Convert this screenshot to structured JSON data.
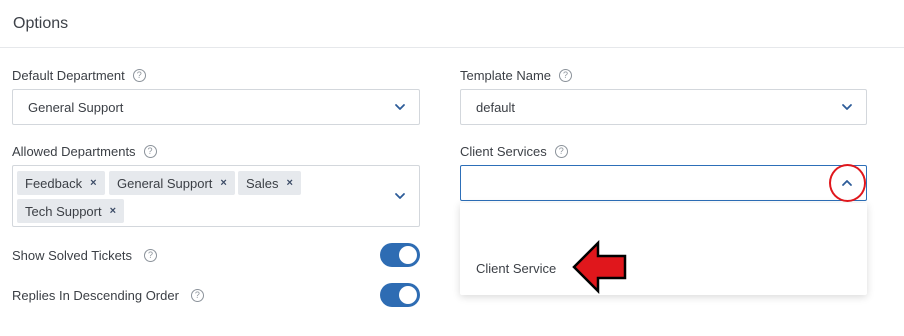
{
  "header": {
    "title": "Options"
  },
  "default_department": {
    "label": "Default Department",
    "value": "General Support"
  },
  "template_name": {
    "label": "Template Name",
    "value": "default"
  },
  "allowed_departments": {
    "label": "Allowed Departments",
    "tags": [
      "Feedback",
      "General Support",
      "Sales",
      "Tech Support"
    ],
    "remove_glyph": "×"
  },
  "client_services": {
    "label": "Client Services",
    "value": "",
    "options": [
      "Client Service"
    ]
  },
  "show_solved_tickets": {
    "label": "Show Solved Tickets",
    "enabled": true
  },
  "replies_descending": {
    "label": "Replies In Descending Order",
    "enabled": true
  },
  "help_glyph": "?",
  "colors": {
    "accent": "#2e6cb3",
    "annotation": "#e0171c"
  }
}
